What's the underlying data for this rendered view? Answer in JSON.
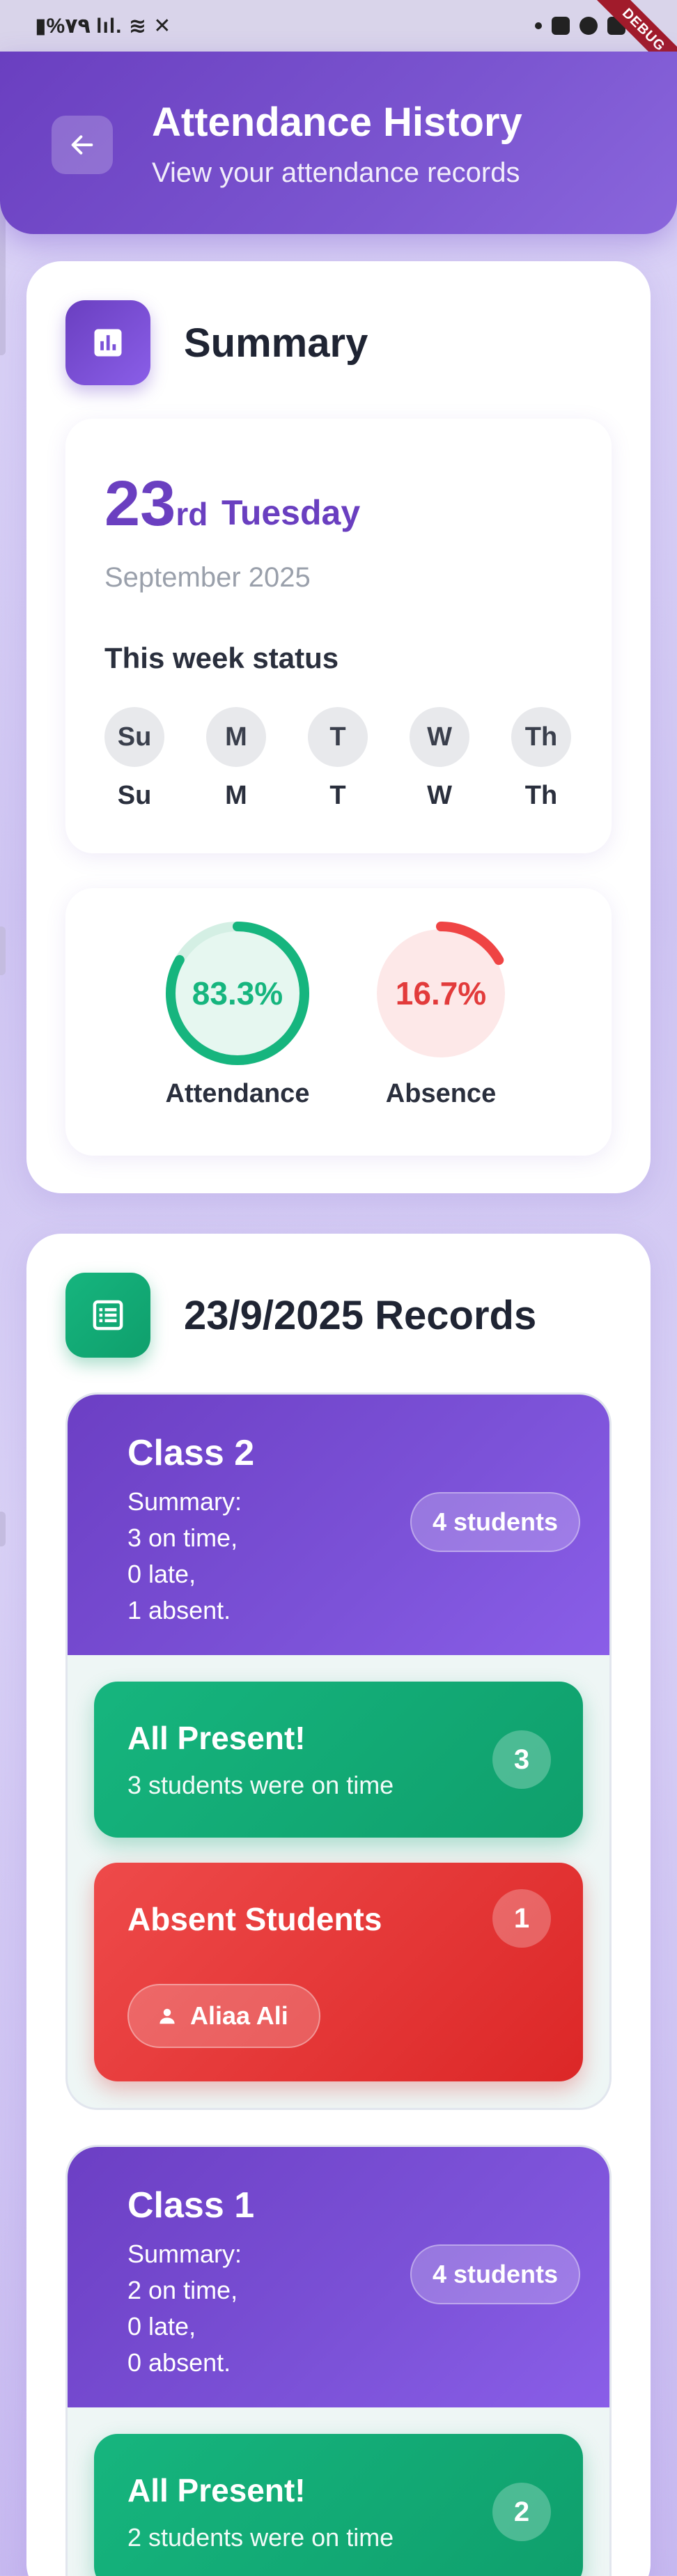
{
  "status_bar": {
    "left_text": "▮%٧٩ lıl. ≋ ✕",
    "debug_label": "DEBUG"
  },
  "header": {
    "title": "Attendance History",
    "subtitle": "View your attendance records",
    "back_icon": "arrow-left-icon"
  },
  "summary": {
    "title": "Summary",
    "icon": "bar-chart-icon",
    "date": {
      "day_number": "23",
      "day_suffix": "rd",
      "weekday": "Tuesday",
      "month_year": "September 2025"
    },
    "week": {
      "label": "This week status",
      "days": [
        {
          "circle": "Su",
          "label": "Su"
        },
        {
          "circle": "M",
          "label": "M"
        },
        {
          "circle": "T",
          "label": "T"
        },
        {
          "circle": "W",
          "label": "W"
        },
        {
          "circle": "Th",
          "label": "Th"
        }
      ]
    },
    "stats": {
      "attendance": {
        "value_text": "83.3%",
        "fraction": 0.833,
        "label": "Attendance",
        "color": "#16b57e"
      },
      "absence": {
        "value_text": "16.7%",
        "fraction": 0.167,
        "label": "Absence",
        "color": "#ef4444"
      }
    }
  },
  "records": {
    "title": "23/9/2025 Records",
    "icon": "list-icon",
    "classes": [
      {
        "name": "Class 2",
        "summary_lines": [
          "Summary:",
          "3 on time,",
          "0 late,",
          "1 absent."
        ],
        "students_label": "4 students",
        "present": {
          "title": "All Present!",
          "subtitle": "3 students were on time",
          "count": "3"
        },
        "absent": {
          "title": "Absent Students",
          "count": "1",
          "students": [
            "Aliaa Ali"
          ]
        }
      },
      {
        "name": "Class 1",
        "summary_lines": [
          "Summary:",
          "2 on time,",
          "0 late,",
          "0 absent."
        ],
        "students_label": "4 students",
        "present": {
          "title": "All Present!",
          "subtitle": "2 students were on time",
          "count": "2"
        }
      }
    ]
  },
  "colors": {
    "primary": "#6a3fc0",
    "success": "#16b57e",
    "danger": "#ef4444"
  }
}
